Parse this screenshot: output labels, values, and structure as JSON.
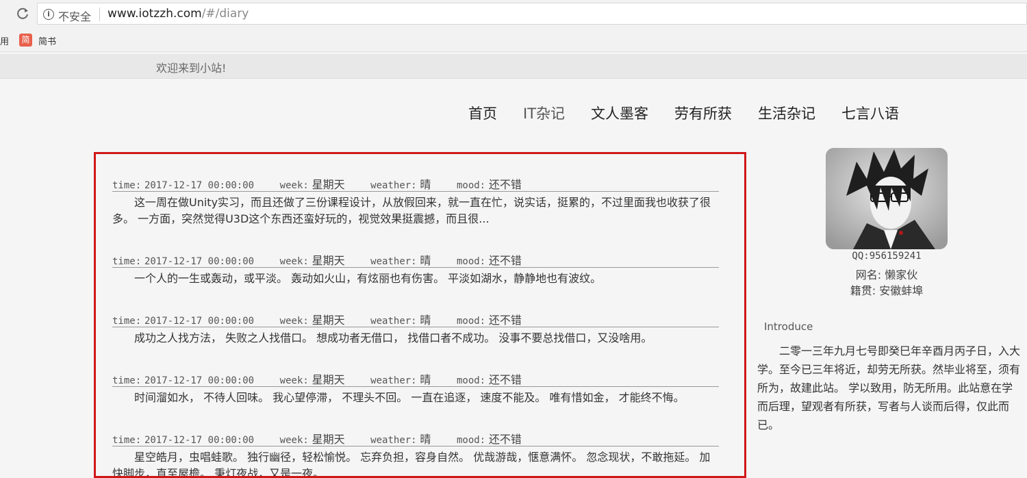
{
  "browser": {
    "insecure_label": "不安全",
    "url_host": "www.iotzzh.com",
    "url_path": "/#/diary",
    "bookmarks": {
      "left_partial": "用",
      "jianshu_icon": "简",
      "jianshu_label": "简书"
    }
  },
  "site": {
    "welcome": "欢迎来到小站!",
    "nav": [
      {
        "label": "首页"
      },
      {
        "label": "IT杂记"
      },
      {
        "label": "文人墨客"
      },
      {
        "label": "劳有所获"
      },
      {
        "label": "生活杂记"
      },
      {
        "label": "七言八语"
      }
    ]
  },
  "diary": {
    "labels": {
      "time": "time:",
      "week": "week:",
      "weather": "weather:",
      "mood": "mood:"
    },
    "entries": [
      {
        "time": "2017-12-17 00:00:00",
        "week": "星期天",
        "weather": "晴",
        "mood": "还不错",
        "body": "这一周在做Unity实习，而且还做了三份课程设计，从放假回来，就一直在忙，说实话，挺累的，不过里面我也收获了很多。 一方面，突然觉得U3D这个东西还蛮好玩的，视觉效果挺震撼，而且很..."
      },
      {
        "time": "2017-12-17 00:00:00",
        "week": "星期天",
        "weather": "晴",
        "mood": "还不错",
        "body": "一个人的一生或轰动，或平淡。 轰动如火山，有炫丽也有伤害。 平淡如湖水，静静地也有波纹。"
      },
      {
        "time": "2017-12-17 00:00:00",
        "week": "星期天",
        "weather": "晴",
        "mood": "还不错",
        "body": "成功之人找方法， 失败之人找借口。 想成功者无借口， 找借口者不成功。 没事不要总找借口，又没啥用。"
      },
      {
        "time": "2017-12-17 00:00:00",
        "week": "星期天",
        "weather": "晴",
        "mood": "还不错",
        "body": "时间溜如水， 不待人回味。 我心望停滞， 不理头不回。 一直在追逐， 速度不能及。 唯有惜如金， 才能终不悔。"
      },
      {
        "time": "2017-12-17 00:00:00",
        "week": "星期天",
        "weather": "晴",
        "mood": "还不错",
        "body": "星空皓月，虫唱蛙歌。 独行幽径，轻松愉悦。 忘弃负担，容身自然。 优哉游哉，惬意满怀。 忽念现状，不敢拖延。 加快脚步，直至屋檐。 秉灯夜战，又是一夜。"
      }
    ]
  },
  "profile": {
    "qq": "QQ:956159241",
    "nickname": "网名: 懒家伙",
    "origin": "籍贯: 安徽蚌埠"
  },
  "introduce": {
    "title": "Introduce",
    "body": "二零一三年九月七号即癸巳年辛酉月丙子日，入大学。至今已三年将近，却劳无所获。然毕业将至，须有所为，故建此站。 学以致用，防无所用。此站意在学而后理，望观者有所获，写者与人谈而后得，仅此而已。"
  },
  "icons": {
    "reload": "reload-icon",
    "info": "info-icon",
    "avatar": "avatar-image"
  },
  "colors": {
    "highlight_border": "#d01818"
  }
}
